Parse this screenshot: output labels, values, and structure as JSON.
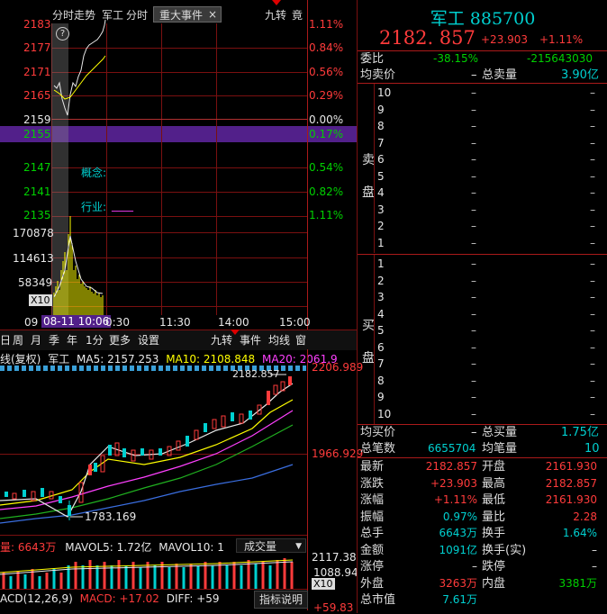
{
  "intraday": {
    "tabs": [
      "分时走势",
      "军工",
      "分时",
      "重大事件",
      "×",
      "九转",
      "竟"
    ],
    "help_icon": "?",
    "price_ticks": [
      "2183",
      "2177",
      "2171",
      "2165",
      "2159",
      "2155",
      "2147",
      "2141",
      "2135"
    ],
    "pct_ticks": [
      "1.11%",
      "0.84%",
      "0.56%",
      "0.29%",
      "0.00%",
      "0.17%",
      "0.54%",
      "0.82%",
      "1.11%"
    ],
    "vol_ticks": [
      "170878",
      "114613",
      "58349"
    ],
    "vol_unit": "X10",
    "concept_label": "概念:",
    "industry_label": "行业:",
    "industry_value": "____",
    "time_labels": [
      "09",
      "08-11 10:06",
      "0:30",
      "11:30",
      "14:00",
      "15:00"
    ]
  },
  "kline": {
    "period_tabs": [
      "日",
      "周",
      "月",
      "季",
      "年",
      "1分",
      "更多",
      "设置"
    ],
    "right_tabs": [
      "九转",
      "事件",
      "均线",
      "窗"
    ],
    "ma_line_prefix": "线(复权)",
    "ma_name": "军工",
    "ma5": "MA5: 2157.253",
    "ma10": "MA10: 2108.848",
    "ma20": "MA20: 2061.9",
    "y_top": "2206.989",
    "y_mid": "1966.929",
    "high_label": "2182.857",
    "low_label": "1783.169",
    "vol_line": "量: 6643万",
    "mavol5": "MAVOL5: 1.72亿",
    "mavol10": "MAVOL10: 1",
    "vol_dropdown": "成交量",
    "vol_ticks": [
      "2117.38",
      "1088.94",
      "X10"
    ],
    "macd_label": "ACD(12,26,9)",
    "macd_value": "MACD: +17.02",
    "diff_value": "DIFF: +59",
    "macd_tick": "+59.83",
    "indicator_btn": "指标说明"
  },
  "quote": {
    "name": "军工",
    "code": "885700",
    "price": "2182. 857",
    "change": "+23.903",
    "change_pct": "+1.11%",
    "weibi_label": "委比",
    "weibi_pct": "-38.15%",
    "weibi_value": "-215643030",
    "avg_sell_label": "均卖价",
    "avg_sell_value": "–",
    "total_sell_label": "总卖量",
    "total_sell_value": "3.90亿",
    "sell_side": "卖",
    "sell_side2": "盘",
    "buy_side": "买",
    "buy_side2": "盘",
    "sell_levels": [
      "10",
      "9",
      "8",
      "7",
      "6",
      "5",
      "4",
      "3",
      "2",
      "1"
    ],
    "buy_levels": [
      "1",
      "2",
      "3",
      "4",
      "5",
      "6",
      "7",
      "8",
      "9",
      "10"
    ],
    "level_dash": "–",
    "avg_buy_label": "均买价",
    "avg_buy_value": "–",
    "total_buy_label": "总买量",
    "total_buy_value": "1.75亿",
    "total_trades_label": "总笔数",
    "total_trades_value": "6655704",
    "avg_trade_label": "均笔量",
    "avg_trade_value": "10",
    "stats": [
      {
        "l1": "最新",
        "v1": "2182.857",
        "c1": "red",
        "l2": "开盘",
        "v2": "2161.930",
        "c2": "red"
      },
      {
        "l1": "涨跌",
        "v1": "+23.903",
        "c1": "red",
        "l2": "最高",
        "v2": "2182.857",
        "c2": "red"
      },
      {
        "l1": "涨幅",
        "v1": "+1.11%",
        "c1": "red",
        "l2": "最低",
        "v2": "2161.930",
        "c2": "red"
      },
      {
        "l1": "振幅",
        "v1": "0.97%",
        "c1": "cyan",
        "l2": "量比",
        "v2": "2.28",
        "c2": "red"
      },
      {
        "l1": "总手",
        "v1": "6643万",
        "c1": "cyan",
        "l2": "换手",
        "v2": "1.64%",
        "c2": "cyan"
      },
      {
        "l1": "金额",
        "v1": "1091亿",
        "c1": "cyan",
        "l2": "换手(实)",
        "v2": "–",
        "c2": "white"
      },
      {
        "l1": "涨停",
        "v1": "–",
        "c1": "white",
        "l2": "跌停",
        "v2": "–",
        "c2": "white"
      },
      {
        "l1": "外盘",
        "v1": "3263万",
        "c1": "red",
        "l2": "内盘",
        "v2": "3381万",
        "c2": "green"
      },
      {
        "l1": "总市值",
        "v1": "7.61万",
        "c1": "cyan",
        "l2": "",
        "v2": "",
        "c2": "white"
      }
    ]
  },
  "colors": {
    "up": "#ff3b3b",
    "down": "#00d000",
    "grid": "#7a1010",
    "accent": "#00d0d0"
  }
}
